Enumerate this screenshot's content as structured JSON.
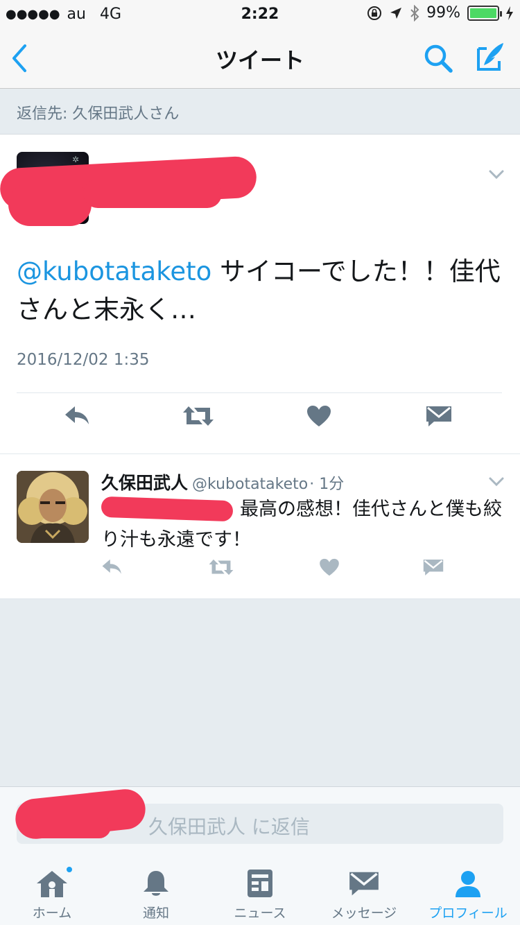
{
  "status_bar": {
    "carrier": "au",
    "network": "4G",
    "time": "2:22",
    "battery": "99%",
    "battery_level": 0.99
  },
  "nav": {
    "title": "ツイート",
    "back_icon": "chevron-left-icon",
    "search_icon": "search-icon",
    "compose_icon": "compose-icon"
  },
  "reply_to": "返信先: 久保田武人さん",
  "main_tweet": {
    "mention": "@kubotataketo",
    "text": " サイコーでした！！佳代さんと末永く…",
    "date": "2016/12/02 1:35"
  },
  "reply_tweet": {
    "name": "久保田武人",
    "handle": "@kubotataketo",
    "time": "· 1分",
    "text": "最高の感想！佳代さんと僕も絞り汁も永遠です！"
  },
  "composer": {
    "placeholder": "久保田武人 に返信"
  },
  "tabs": [
    {
      "label": "ホーム",
      "icon": "home-icon"
    },
    {
      "label": "通知",
      "icon": "bell-icon"
    },
    {
      "label": "ニュース",
      "icon": "news-icon"
    },
    {
      "label": "メッセージ",
      "icon": "envelope-icon"
    },
    {
      "label": "プロフィール",
      "icon": "profile-icon"
    }
  ],
  "colors": {
    "accent": "#1da1f2",
    "mention": "#1b95e0",
    "muted": "#657786",
    "redaction": "#f23a5a"
  }
}
